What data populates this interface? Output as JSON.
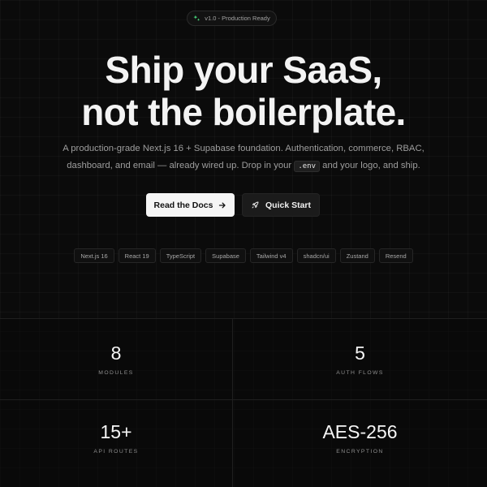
{
  "badge": {
    "icon": "sparkle-icon",
    "text": "v1.0 - Production Ready",
    "icon_color": "#4ade80"
  },
  "hero": {
    "headline_line1": "Ship your SaaS,",
    "headline_line2": "not the boilerplate.",
    "subtitle_line1": "A production-grade Next.js 16 + Supabase foundation. Authentication, commerce, RBAC,",
    "subtitle_line2_before": "dashboard, and email — already wired up. Drop in your",
    "subtitle_code": ".env",
    "subtitle_line2_after": "and your logo, and ship."
  },
  "buttons": {
    "primary": {
      "label": "Read the Docs",
      "icon": "arrow-right-icon"
    },
    "secondary": {
      "label": "Quick Start",
      "icon": "rocket-icon"
    }
  },
  "tech_stack": [
    "Next.js 16",
    "React 19",
    "TypeScript",
    "Supabase",
    "Tailwind v4",
    "shadcn/ui",
    "Zustand",
    "Resend"
  ],
  "stats": [
    {
      "value": "8",
      "label": "MODULES"
    },
    {
      "value": "5",
      "label": "AUTH FLOWS"
    },
    {
      "value": "15+",
      "label": "API ROUTES"
    },
    {
      "value": "AES-256",
      "label": "ENCRYPTION"
    }
  ],
  "colors": {
    "background": "#0b0b0b",
    "accent": "#4ade80",
    "primary_button": "#f5f5f5"
  }
}
